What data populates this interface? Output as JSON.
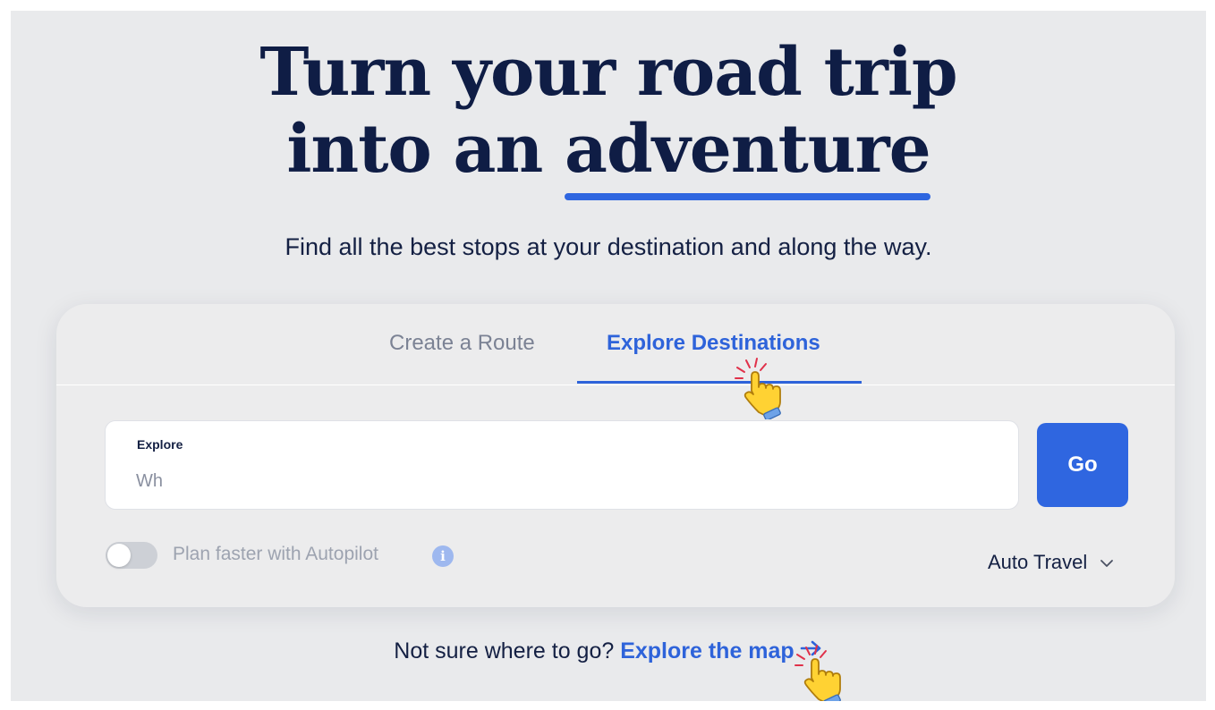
{
  "hero": {
    "title_line1": "Turn your road trip",
    "title_line2_prefix": "into an ",
    "title_line2_accent": "adventure",
    "subtitle": "Find all the best stops at your destination and along the way."
  },
  "tabs": [
    {
      "label": "Create a Route",
      "active": false
    },
    {
      "label": "Explore Destinations",
      "active": true
    }
  ],
  "explore": {
    "label": "Explore",
    "value": "",
    "placeholder": "Wh"
  },
  "go_button": {
    "label": "Go"
  },
  "autopilot": {
    "label": "Plan faster with Autopilot",
    "enabled": false,
    "info_glyph": "i"
  },
  "travel_mode": {
    "label": "Auto Travel",
    "icon": "chevron-down-icon"
  },
  "footer": {
    "prompt": "Not sure where to go? ",
    "link": "Explore the map",
    "link_icon": "arrow-right-icon"
  },
  "colors": {
    "brand_blue": "#2f66e0",
    "navy_text": "#0f1d45",
    "background": "#e9eaec",
    "muted_text": "#9da3b0"
  }
}
